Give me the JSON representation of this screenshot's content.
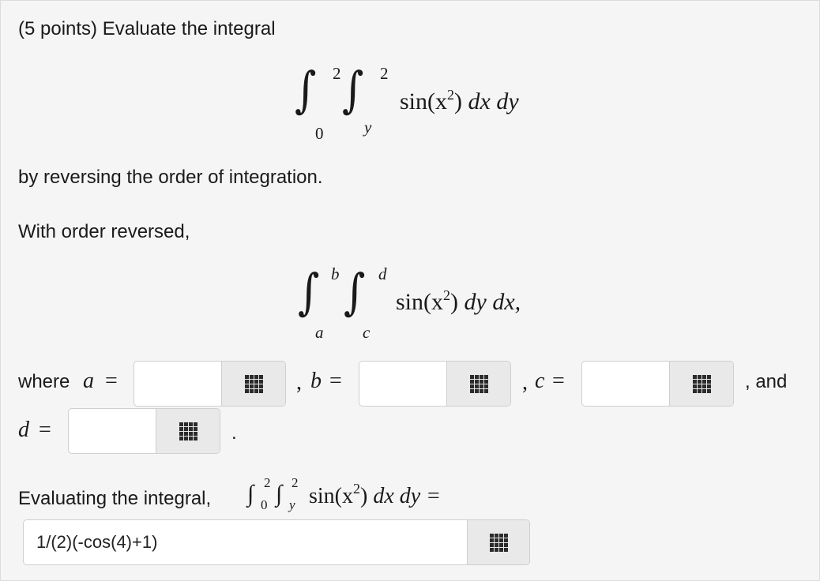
{
  "question": {
    "header": "(5 points) Evaluate the integral",
    "reverse_text": "by reversing the order of integration.",
    "with_order_text": "With order reversed,",
    "integral1": {
      "outer_lower": "0",
      "outer_upper": "2",
      "inner_lower": "y",
      "inner_upper": "2",
      "func": "sin(x",
      "power": "2",
      "close": ")",
      "diffs": "dx dy"
    },
    "integral2": {
      "outer_lower": "a",
      "outer_upper": "b",
      "inner_lower": "c",
      "inner_upper": "d",
      "func": "sin(x",
      "power": "2",
      "close": ")",
      "diffs": "dy dx,"
    },
    "where_text": "where",
    "var_a": "a",
    "var_b": "b",
    "var_c": "c",
    "var_d": "d",
    "eq": "=",
    "comma_b": ",",
    "comma_c": ",",
    "and_text": ", and",
    "period": ".",
    "evaluating_text": "Evaluating the integral,",
    "inline_integral": {
      "outer_lower": "0",
      "outer_upper": "2",
      "inner_lower": "y",
      "inner_upper": "2",
      "func": "sin(x",
      "power": "2",
      "close": ")",
      "diffs": "dx dy ="
    }
  },
  "answers": {
    "a_value": "",
    "b_value": "",
    "c_value": "",
    "d_value": "",
    "final_value": "1/(2)(-cos(4)+1)"
  },
  "icons": {
    "palette_button": "grid-keypad-icon"
  }
}
